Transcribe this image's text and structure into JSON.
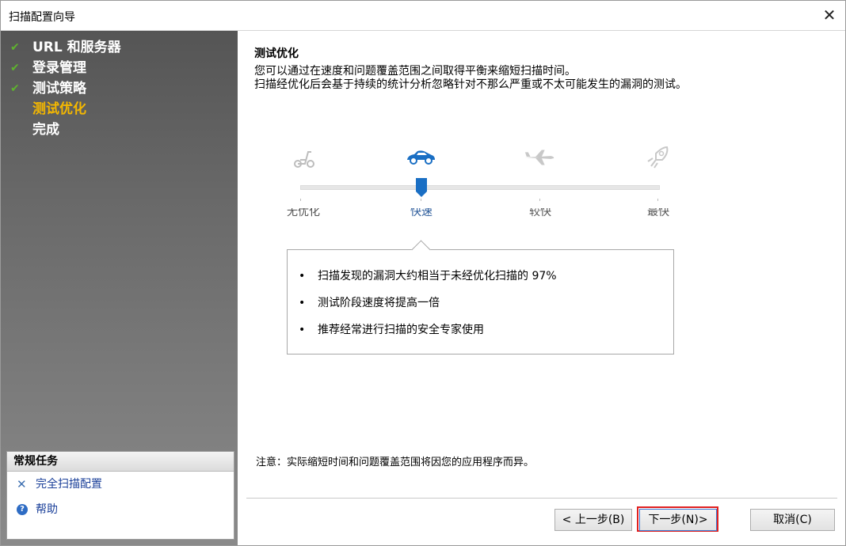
{
  "window": {
    "title": "扫描配置向导"
  },
  "sidebar": {
    "steps": [
      {
        "label": "URL 和服务器",
        "done": true
      },
      {
        "label": "登录管理",
        "done": true
      },
      {
        "label": "测试策略",
        "done": true
      },
      {
        "label": "测试优化",
        "current": true
      },
      {
        "label": "完成"
      }
    ],
    "tasks": {
      "title": "常规任务",
      "items": [
        {
          "label": "完全扫描配置",
          "icon": "tools-icon"
        },
        {
          "label": "帮助",
          "icon": "help-icon"
        }
      ]
    }
  },
  "main": {
    "title": "测试优化",
    "description": [
      "您可以通过在速度和问题覆盖范围之间取得平衡来缩短扫描时间。",
      "扫描经优化后会基于持续的统计分析忽略针对不那么严重或不太可能发生的漏洞的测试。"
    ],
    "slider": {
      "selected_index": 1,
      "levels": [
        {
          "label": "无优化",
          "icon": "scooter-icon"
        },
        {
          "label": "快速",
          "icon": "car-icon"
        },
        {
          "label": "较快",
          "icon": "plane-icon"
        },
        {
          "label": "最快",
          "icon": "rocket-icon"
        }
      ]
    },
    "info_bullets": [
      "扫描发现的漏洞大约相当于未经优化扫描的 97%",
      "测试阶段速度将提高一倍",
      "推荐经常进行扫描的安全专家使用"
    ],
    "note": "注意：实际缩短时间和问题覆盖范围将因您的应用程序而异。"
  },
  "buttons": {
    "back": "< 上一步(B)",
    "next": "下一步(N)>",
    "cancel": "取消(C)"
  },
  "colors": {
    "check": "#5fb22f",
    "current_step": "#f5b800",
    "accent": "#1a6fc4",
    "highlight_border": "#e02020"
  }
}
